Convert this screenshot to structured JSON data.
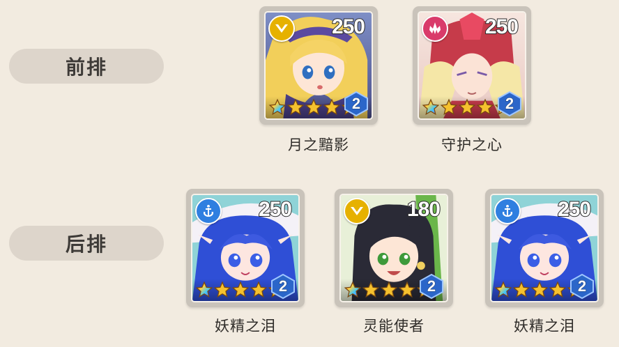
{
  "rows": {
    "front": {
      "label": "前排"
    },
    "back": {
      "label": "后排"
    }
  },
  "heroes": {
    "front_1": {
      "name": "月之黯影",
      "power": "250",
      "level": "2",
      "type_icon": "chevron-badge-icon",
      "type_color": "#e6b100"
    },
    "front_2": {
      "name": "守护之心",
      "power": "250",
      "level": "2",
      "type_icon": "crystal-badge-icon",
      "type_color": "#d93b6a"
    },
    "back_1": {
      "name": "妖精之泪",
      "power": "250",
      "level": "2",
      "type_icon": "anchor-badge-icon",
      "type_color": "#2f7fe0"
    },
    "back_2": {
      "name": "灵能使者",
      "power": "180",
      "level": "2",
      "type_icon": "chevron-badge-icon",
      "type_color": "#e6b100"
    },
    "back_3": {
      "name": "妖精之泪",
      "power": "250",
      "level": "2",
      "type_icon": "anchor-badge-icon",
      "type_color": "#2f7fe0"
    }
  },
  "stars_per_hero": 5
}
